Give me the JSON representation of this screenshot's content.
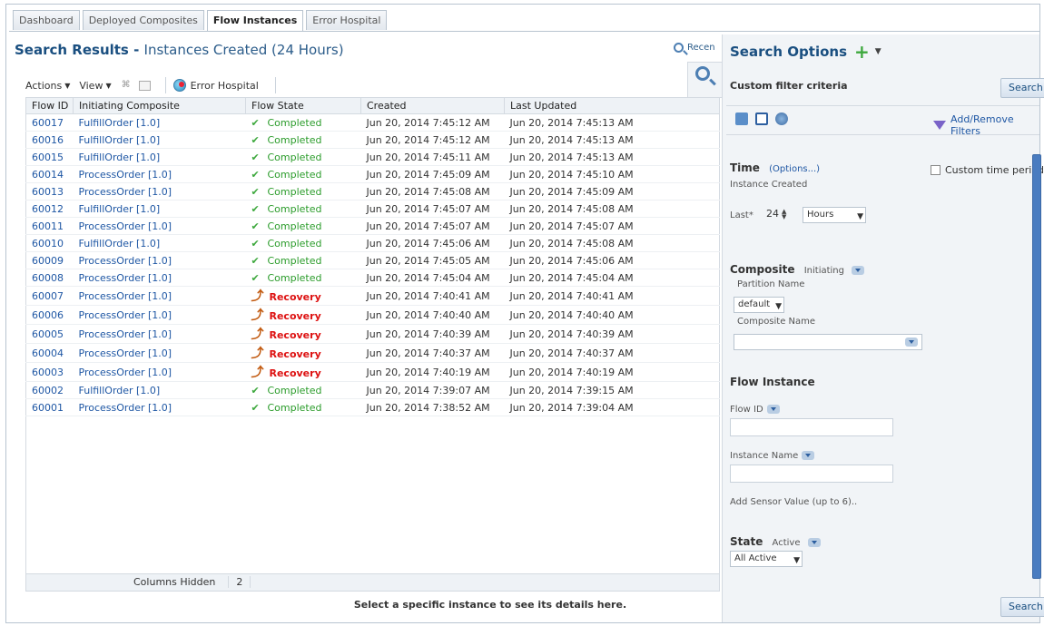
{
  "tabs": [
    "Dashboard",
    "Deployed Composites",
    "Flow Instances",
    "Error Hospital"
  ],
  "results": {
    "title_bold": "Search Results - ",
    "title_rest": "Instances Created (24 Hours)",
    "recent_label": "Recen"
  },
  "toolbar": {
    "actions": "Actions",
    "view": "View",
    "error_hospital": "Error Hospital"
  },
  "grid": {
    "columns": [
      "Flow ID",
      "Initiating Composite",
      "Flow State",
      "Created",
      "Last Updated"
    ],
    "rows": [
      {
        "id": "60017",
        "composite": "FulfillOrder [1.0]",
        "state": "Completed",
        "created": "Jun 20, 2014 7:45:12 AM",
        "updated": "Jun 20, 2014 7:45:13 AM"
      },
      {
        "id": "60016",
        "composite": "FulfillOrder [1.0]",
        "state": "Completed",
        "created": "Jun 20, 2014 7:45:12 AM",
        "updated": "Jun 20, 2014 7:45:13 AM"
      },
      {
        "id": "60015",
        "composite": "FulfillOrder [1.0]",
        "state": "Completed",
        "created": "Jun 20, 2014 7:45:11 AM",
        "updated": "Jun 20, 2014 7:45:13 AM"
      },
      {
        "id": "60014",
        "composite": "ProcessOrder [1.0]",
        "state": "Completed",
        "created": "Jun 20, 2014 7:45:09 AM",
        "updated": "Jun 20, 2014 7:45:10 AM"
      },
      {
        "id": "60013",
        "composite": "ProcessOrder [1.0]",
        "state": "Completed",
        "created": "Jun 20, 2014 7:45:08 AM",
        "updated": "Jun 20, 2014 7:45:09 AM"
      },
      {
        "id": "60012",
        "composite": "FulfillOrder [1.0]",
        "state": "Completed",
        "created": "Jun 20, 2014 7:45:07 AM",
        "updated": "Jun 20, 2014 7:45:08 AM"
      },
      {
        "id": "60011",
        "composite": "ProcessOrder [1.0]",
        "state": "Completed",
        "created": "Jun 20, 2014 7:45:07 AM",
        "updated": "Jun 20, 2014 7:45:07 AM"
      },
      {
        "id": "60010",
        "composite": "FulfillOrder [1.0]",
        "state": "Completed",
        "created": "Jun 20, 2014 7:45:06 AM",
        "updated": "Jun 20, 2014 7:45:08 AM"
      },
      {
        "id": "60009",
        "composite": "ProcessOrder [1.0]",
        "state": "Completed",
        "created": "Jun 20, 2014 7:45:05 AM",
        "updated": "Jun 20, 2014 7:45:06 AM"
      },
      {
        "id": "60008",
        "composite": "ProcessOrder [1.0]",
        "state": "Completed",
        "created": "Jun 20, 2014 7:45:04 AM",
        "updated": "Jun 20, 2014 7:45:04 AM"
      },
      {
        "id": "60007",
        "composite": "ProcessOrder [1.0]",
        "state": "Recovery",
        "created": "Jun 20, 2014 7:40:41 AM",
        "updated": "Jun 20, 2014 7:40:41 AM"
      },
      {
        "id": "60006",
        "composite": "ProcessOrder [1.0]",
        "state": "Recovery",
        "created": "Jun 20, 2014 7:40:40 AM",
        "updated": "Jun 20, 2014 7:40:40 AM"
      },
      {
        "id": "60005",
        "composite": "ProcessOrder [1.0]",
        "state": "Recovery",
        "created": "Jun 20, 2014 7:40:39 AM",
        "updated": "Jun 20, 2014 7:40:39 AM"
      },
      {
        "id": "60004",
        "composite": "ProcessOrder [1.0]",
        "state": "Recovery",
        "created": "Jun 20, 2014 7:40:37 AM",
        "updated": "Jun 20, 2014 7:40:37 AM"
      },
      {
        "id": "60003",
        "composite": "ProcessOrder [1.0]",
        "state": "Recovery",
        "created": "Jun 20, 2014 7:40:19 AM",
        "updated": "Jun 20, 2014 7:40:19 AM"
      },
      {
        "id": "60002",
        "composite": "FulfillOrder [1.0]",
        "state": "Completed",
        "created": "Jun 20, 2014 7:39:07 AM",
        "updated": "Jun 20, 2014 7:39:15 AM"
      },
      {
        "id": "60001",
        "composite": "ProcessOrder [1.0]",
        "state": "Completed",
        "created": "Jun 20, 2014 7:38:52 AM",
        "updated": "Jun 20, 2014 7:39:04 AM"
      }
    ],
    "columns_hidden_label": "Columns Hidden",
    "columns_hidden_count": "2"
  },
  "detail_message": "Select a specific instance to see its details here.",
  "search_options": {
    "title": "Search Options",
    "custom_filter": "Custom filter criteria",
    "search_button": "Search",
    "add_remove_filters": "Add/Remove Filters",
    "time": {
      "title": "Time",
      "options_link": "(Options...)",
      "custom_time_period": "Custom time period",
      "instance_created": "Instance Created",
      "last_label": "Last*",
      "last_value": "24",
      "unit": "Hours"
    },
    "composite": {
      "title": "Composite",
      "sub": "Initiating",
      "partition_label": "Partition Name",
      "partition_value": "default",
      "composite_name_label": "Composite Name",
      "composite_name_value": ""
    },
    "flow_instance": {
      "title": "Flow Instance",
      "flow_id_label": "Flow ID",
      "flow_id_value": "",
      "instance_name_label": "Instance Name",
      "instance_name_value": "",
      "add_sensor_link": "Add Sensor Value (up to 6).."
    },
    "state": {
      "title": "State",
      "sub": "Active",
      "value": "All Active"
    }
  },
  "colors": {
    "link_blue": "#1f57a4",
    "completed_green": "#2b9c2b",
    "recovery_red": "#dd1111",
    "panel_bg": "#f1f4f7"
  }
}
